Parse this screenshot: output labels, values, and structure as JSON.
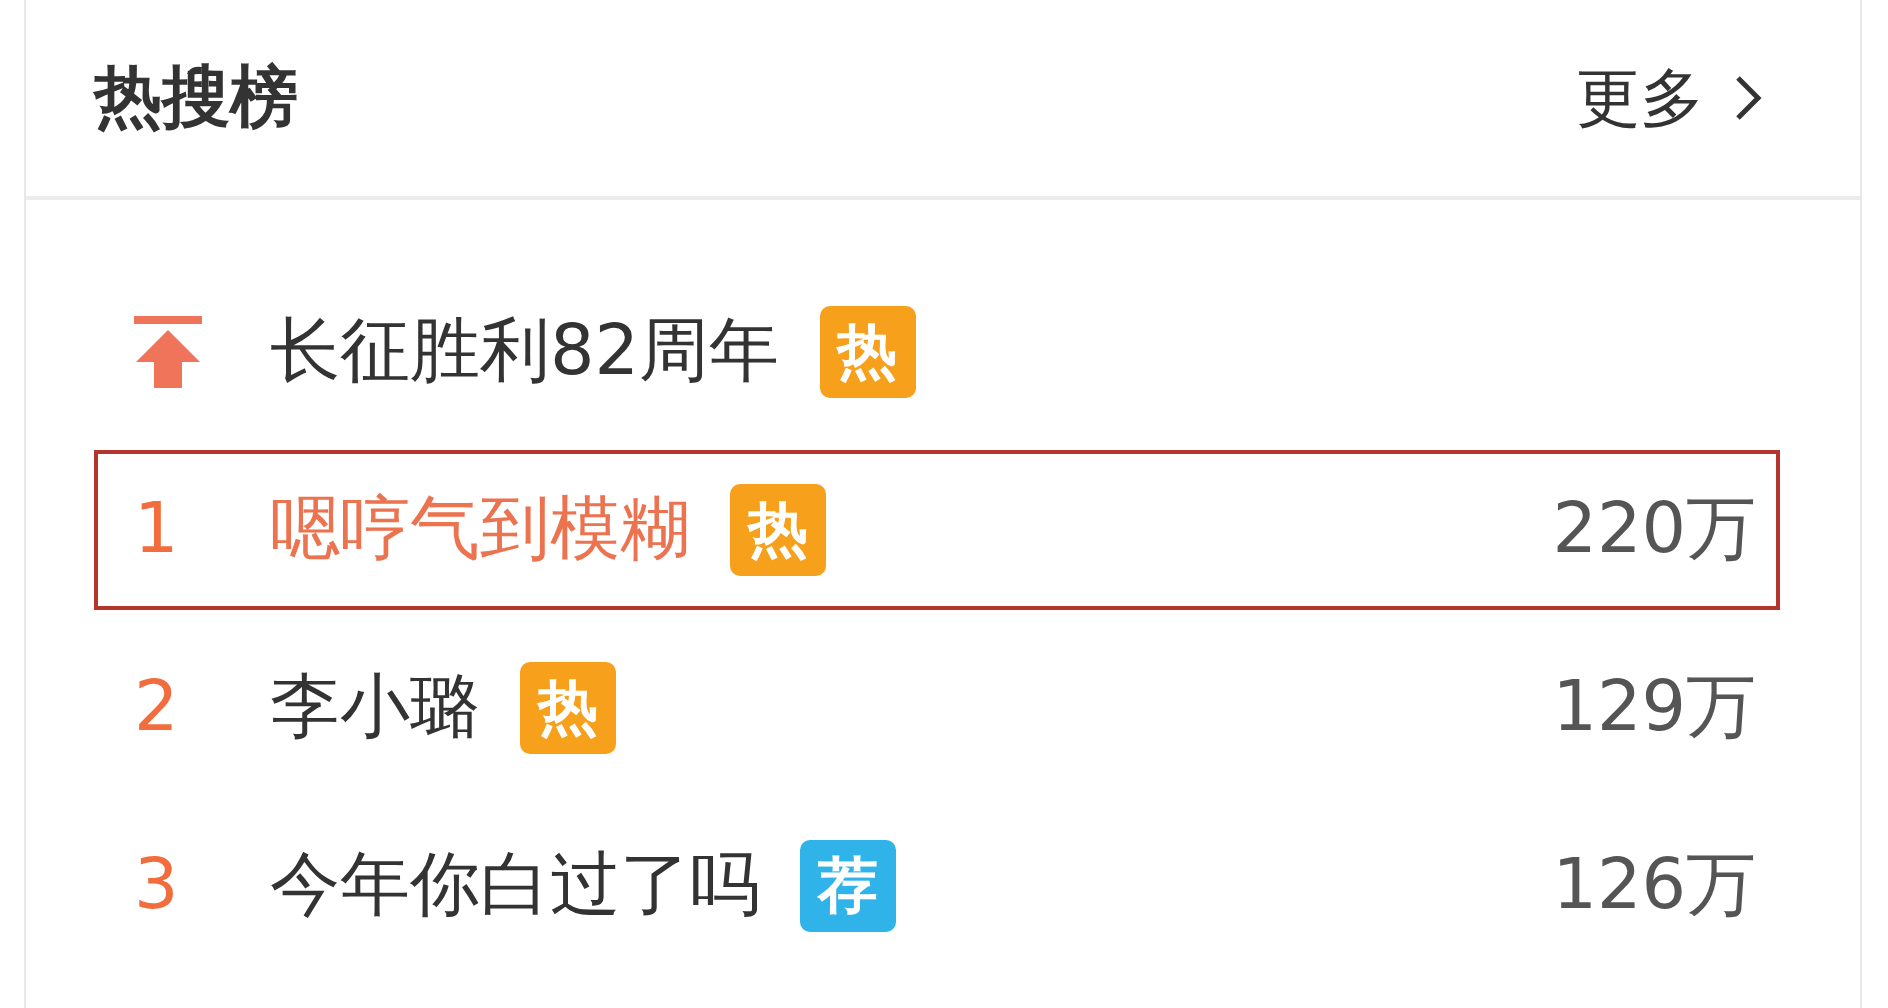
{
  "header": {
    "title": "热搜榜",
    "more": "更多"
  },
  "items": [
    {
      "kind": "pinned",
      "text": "长征胜利82周年",
      "tag": "热",
      "color": "#f6a01c",
      "selected": false
    },
    {
      "kind": "ranked",
      "rank": "1",
      "text": "嗯哼气到模糊",
      "tag": "热",
      "color": "#f6a01c",
      "count": "220万",
      "selected": true
    },
    {
      "kind": "ranked",
      "rank": "2",
      "text": "李小璐",
      "tag": "热",
      "color": "#f6a01c",
      "count": "129万",
      "selected": false
    },
    {
      "kind": "ranked",
      "rank": "3",
      "text": "今年你白过了吗",
      "tag": "荐",
      "color": "#2fb3e8",
      "count": "126万",
      "selected": false
    }
  ]
}
